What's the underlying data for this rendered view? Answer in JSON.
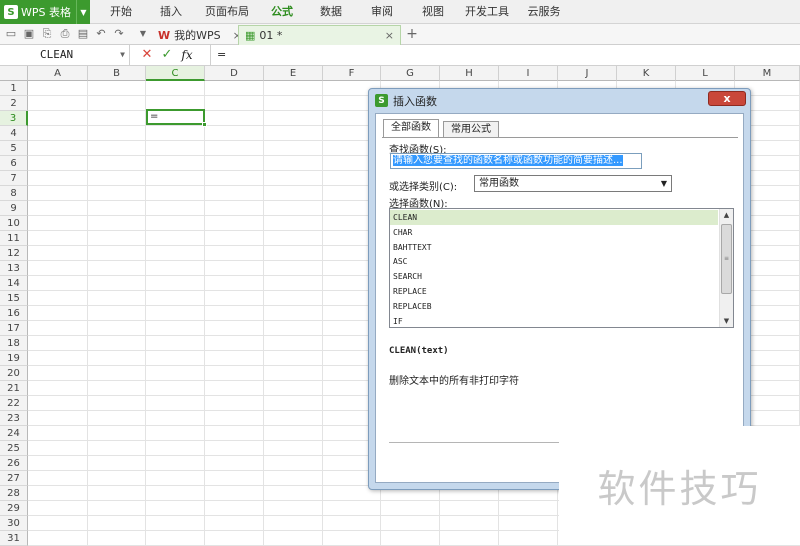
{
  "app": {
    "name": "WPS 表格",
    "logo": "S"
  },
  "menu": [
    "开始",
    "插入",
    "页面布局",
    "公式",
    "数据",
    "审阅",
    "视图",
    "开发工具",
    "云服务"
  ],
  "active_menu": "公式",
  "tabs": [
    {
      "label": "我的WPS",
      "close": "×"
    },
    {
      "label": "01 *",
      "close": "×"
    }
  ],
  "new_tab": "+",
  "formula_bar": {
    "name_box": "CLEAN",
    "cancel": "✕",
    "confirm": "✓",
    "fx": "fx",
    "content": "="
  },
  "grid": {
    "columns": [
      "A",
      "B",
      "C",
      "D",
      "E",
      "F",
      "G",
      "H",
      "I",
      "J",
      "K",
      "L",
      "M"
    ],
    "rows": [
      "1",
      "2",
      "3",
      "4",
      "5",
      "6",
      "7",
      "8",
      "9",
      "10",
      "11",
      "12",
      "13",
      "14",
      "15",
      "16",
      "17",
      "18",
      "19",
      "20",
      "21",
      "22",
      "23",
      "24",
      "25",
      "26",
      "27",
      "28",
      "29",
      "30",
      "31"
    ],
    "selected_column": "C",
    "selected_row": "3",
    "active_cell_value": "="
  },
  "dialog": {
    "title": "插入函数",
    "logo": "S",
    "close": "x",
    "tabs": [
      "全部函数",
      "常用公式"
    ],
    "search_label": "查找函数(S):",
    "search_placeholder": "请输入您要查找的函数名称或函数功能的简要描述...",
    "category_label": "或选择类别(C):",
    "category_value": "常用函数",
    "function_list_label": "选择函数(N):",
    "functions": [
      "CLEAN",
      "CHAR",
      "BAHTTEXT",
      "ASC",
      "SEARCH",
      "REPLACE",
      "REPLACEB",
      "IF"
    ],
    "selected_function": "CLEAN",
    "signature": "CLEAN(text)",
    "description": "删除文本中的所有非打印字符"
  },
  "watermark": "软件技巧",
  "colors": {
    "accent": "#3c9a2e",
    "selection": "#dceccd",
    "dialog_frame": "#c5d8ec"
  }
}
